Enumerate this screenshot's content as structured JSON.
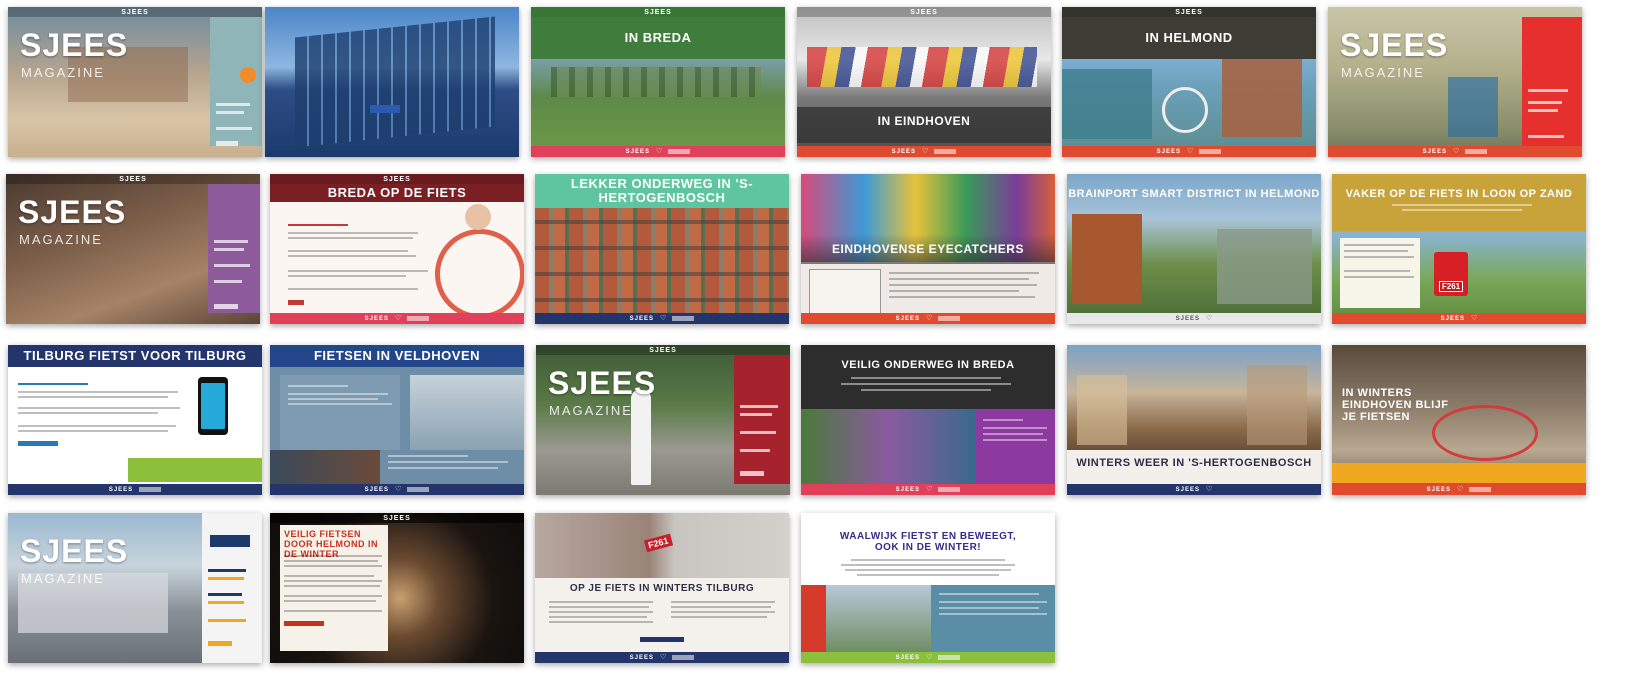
{
  "thumbnails": [
    {
      "id": "t01",
      "brand": "SJEES",
      "logo": "SJEES",
      "logo_sub": "MAGAZINE",
      "heading": "",
      "bottom_color": "#8fb5b8"
    },
    {
      "id": "t02",
      "brand": "",
      "heading": "",
      "bottom_color": "#1c3a6c"
    },
    {
      "id": "t03",
      "brand": "SJEES",
      "heading": "IN BREDA",
      "bottom_color": "#e0405a",
      "bottom_brand": "SJEES"
    },
    {
      "id": "t04",
      "brand": "SJEES",
      "heading": "IN EINDHOVEN",
      "bottom_color": "#e04b30",
      "bottom_brand": "SJEES"
    },
    {
      "id": "t05",
      "brand": "SJEES",
      "heading": "IN HELMOND",
      "bottom_color": "#e04b30",
      "bottom_brand": "SJEES"
    },
    {
      "id": "t06",
      "brand": "",
      "logo": "SJEES",
      "logo_sub": "MAGAZINE",
      "heading": "",
      "bottom_color": "#e04b30",
      "bottom_brand": "SJEES"
    },
    {
      "id": "t07",
      "brand": "SJEES",
      "logo": "SJEES",
      "logo_sub": "MAGAZINE",
      "heading": "",
      "bottom_color": "#8d5b9c"
    },
    {
      "id": "t08",
      "brand": "SJEES",
      "heading": "BREDA OP DE FIETS",
      "bottom_color": "#e0405a",
      "bottom_brand": "SJEES"
    },
    {
      "id": "t09",
      "brand": "",
      "heading": "LEKKER ONDERWEG IN 'S-HERTOGENBOSCH",
      "bottom_color": "#23356b",
      "bottom_brand": "SJEES"
    },
    {
      "id": "t10",
      "brand": "",
      "heading": "EINDHOVENSE EYECATCHERS",
      "bottom_color": "#e04b30",
      "bottom_brand": "SJEES"
    },
    {
      "id": "t11",
      "brand": "",
      "heading": "BRAINPORT SMART DISTRICT IN HELMOND",
      "bottom_color": "#e04b30",
      "bottom_brand": "SJEES"
    },
    {
      "id": "t12",
      "brand": "",
      "heading": "VAKER OP DE FIETS IN LOON OP ZAND",
      "sign_text": "F261",
      "bottom_color": "#e04b30",
      "bottom_brand": "SJEES"
    },
    {
      "id": "t13",
      "brand": "",
      "heading": "TILBURG FIETST VOOR TILBURG",
      "bottom_color": "#23356b",
      "bottom_brand": "SJEES"
    },
    {
      "id": "t14",
      "brand": "",
      "heading": "FIETSEN IN VELDHOVEN",
      "bottom_color": "#23356b",
      "bottom_brand": "SJEES"
    },
    {
      "id": "t15",
      "brand": "SJEES",
      "logo": "SJEES",
      "logo_sub": "MAGAZINE",
      "heading": "",
      "bottom_color": "#a6222d"
    },
    {
      "id": "t16",
      "brand": "",
      "heading": "VEILIG ONDERWEG IN BREDA",
      "bottom_color": "#e0405a",
      "bottom_brand": "SJEES"
    },
    {
      "id": "t17",
      "brand": "",
      "heading": "WINTERS WEER IN 'S-HERTOGENBOSCH",
      "bottom_color": "#23356b",
      "bottom_brand": "SJEES"
    },
    {
      "id": "t18",
      "brand": "",
      "heading": "IN WINTERS EINDHOVEN BLIJF JE FIETSEN",
      "bottom_color": "#e04b30",
      "bottom_brand": "SJEES"
    },
    {
      "id": "t19",
      "brand": "",
      "logo": "SJEES",
      "logo_sub": "MAGAZINE",
      "heading": "",
      "bottom_color": "#e8e8e8"
    },
    {
      "id": "t20",
      "brand": "SJEES",
      "heading": "VEILIG FIETSEN DOOR HELMOND IN DE WINTER",
      "bottom_color": "#444444"
    },
    {
      "id": "t21",
      "brand": "SJEES",
      "heading": "OP JE FIETS IN WINTERS TILBURG",
      "sign_text": "F261",
      "bottom_color": "#23356b",
      "bottom_brand": "SJEES"
    },
    {
      "id": "t22",
      "brand": "",
      "heading": "WAALWIJK FIETST EN BEWEEGT, OOK IN DE WINTER!",
      "bottom_color": "#8bbf3c",
      "bottom_brand": "SJEES"
    }
  ]
}
